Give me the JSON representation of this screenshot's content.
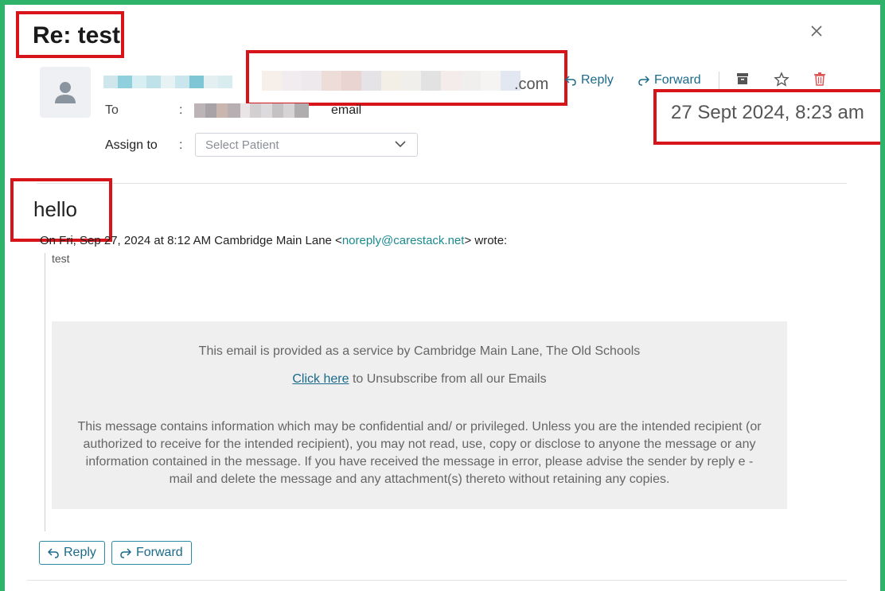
{
  "subject": "Re: test",
  "sender": {
    "domain_visible": ".com"
  },
  "header_actions": {
    "reply": "Reply",
    "forward": "Forward"
  },
  "to": {
    "label": "To",
    "colon": ":",
    "email_suffix": "email"
  },
  "date": "27 Sept 2024, 8:23 am",
  "assign": {
    "label": "Assign to",
    "colon": ":",
    "placeholder": "Select Patient"
  },
  "body": {
    "text": "hello",
    "quote_header_prefix": "On Fri, Sep 27, 2024 at 8:12 AM Cambridge Main Lane <",
    "quote_header_email": "noreply@carestack.net",
    "quote_header_suffix": "> wrote:",
    "quoted_text": "test"
  },
  "footer": {
    "service_line": "This email is provided as a service by Cambridge Main Lane, The Old Schools",
    "click_here": "Click here",
    "unsubscribe_rest": " to Unsubscribe from all our Emails",
    "disclaimer": "This message contains information which may be confidential and/ or privileged. Unless you are the intended recipient (or authorized to receive for the intended recipient), you may not read, use, copy or disclose to anyone the message or any information contained in the message. If you have received the message in error, please advise the sender by reply e - mail and delete the message and any attachment(s) thereto without retaining any copies."
  },
  "bottom_actions": {
    "reply": "Reply",
    "forward": "Forward"
  },
  "colors": {
    "frame_border": "#2fb36b",
    "annotation_red": "#d7141a",
    "accent": "#1a6a8a",
    "link_teal": "#1a8a8f",
    "delete_red": "#e05555"
  },
  "icons": [
    "close-icon",
    "user-avatar-icon",
    "reply-icon",
    "forward-icon",
    "archive-icon",
    "star-icon",
    "trash-icon",
    "chevron-down-icon"
  ]
}
